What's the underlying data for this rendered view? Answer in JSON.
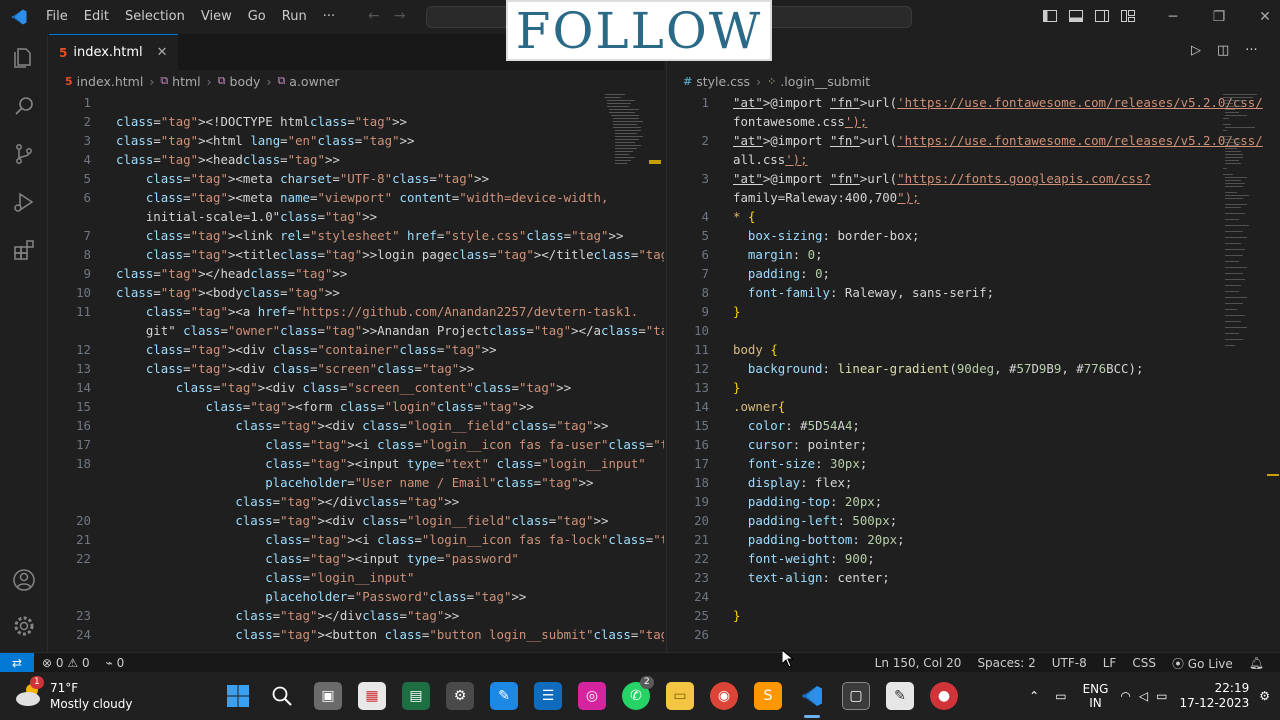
{
  "titlebar": {
    "menu": [
      "File",
      "Edit",
      "Selection",
      "View",
      "Go",
      "Run",
      "···"
    ],
    "icons": [
      "vscode-logo",
      "back-arrow",
      "forward-arrow",
      "toggle-primary-sidebar",
      "toggle-panel",
      "toggle-secondary-sidebar",
      "customize-layout",
      "minimize",
      "restore",
      "close"
    ]
  },
  "overlay": {
    "text": "FOLLOW"
  },
  "activitybar": [
    "explorer-icon",
    "search-icon",
    "source-control-icon",
    "run-debug-icon",
    "extensions-icon",
    "accounts-icon",
    "manage-icon"
  ],
  "left_pane": {
    "tab": "index.html",
    "breadcrumb": [
      "index.html",
      "html",
      "body",
      "a.owner"
    ],
    "lines": [
      {
        "n": "1",
        "t": ""
      },
      {
        "n": "2",
        "t": "<!DOCTYPE html>"
      },
      {
        "n": "3",
        "t": "<html lang=\"en\">"
      },
      {
        "n": "4",
        "t": "<head>"
      },
      {
        "n": "5",
        "t": "    <meta charset=\"UTF-8\">"
      },
      {
        "n": "6",
        "t": "    <meta name=\"viewport\" content=\"width=device-width,"
      },
      {
        "n": "",
        "t": "    initial-scale=1.0\">"
      },
      {
        "n": "7",
        "t": "    <link rel=\"stylesheet\" href=\"style.css\">"
      },
      {
        "n": "8",
        "t": "    <title>login page</title>"
      },
      {
        "n": "9",
        "t": "</head>"
      },
      {
        "n": "10",
        "t": "<body>"
      },
      {
        "n": "11",
        "t": "    <a href=\"https://github.com/Anandan2257/devtern-task1."
      },
      {
        "n": "",
        "t": "    git\" class=\"owner\">Anandan Project</a>"
      },
      {
        "n": "12",
        "t": "    <div class=\"container\">"
      },
      {
        "n": "13",
        "t": "    <div class=\"screen\">"
      },
      {
        "n": "14",
        "t": "        <div class=\"screen__content\">"
      },
      {
        "n": "15",
        "t": "            <form class=\"login\">"
      },
      {
        "n": "16",
        "t": "                <div class=\"login__field\">"
      },
      {
        "n": "17",
        "t": "                    <i class=\"login__icon fas fa-user\"></i>"
      },
      {
        "n": "18",
        "t": "                    <input type=\"text\" class=\"login__input\""
      },
      {
        "n": "",
        "t": "                    placeholder=\"User name / Email\">"
      },
      {
        "n": "",
        "t": "                </div>"
      },
      {
        "n": "20",
        "t": "                <div class=\"login__field\">"
      },
      {
        "n": "21",
        "t": "                    <i class=\"login__icon fas fa-lock\"></i>"
      },
      {
        "n": "22",
        "t": "                    <input type=\"password\""
      },
      {
        "n": "",
        "t": "                    class=\"login__input\""
      },
      {
        "n": "",
        "t": "                    placeholder=\"Password\">"
      },
      {
        "n": "23",
        "t": "                </div>"
      },
      {
        "n": "24",
        "t": "                <button class=\"button login__submit\">"
      }
    ]
  },
  "right_pane": {
    "tab": "style.css",
    "breadcrumb": [
      "style.css",
      ".login__submit"
    ],
    "lines": [
      {
        "n": "1",
        "t": "@import url('https://use.fontawesome.com/releases/v5.2.0/css/"
      },
      {
        "n": "",
        "t": "fontawesome.css');"
      },
      {
        "n": "2",
        "t": "@import url('https://use.fontawesome.com/releases/v5.2.0/css/"
      },
      {
        "n": "",
        "t": "all.css');"
      },
      {
        "n": "3",
        "t": "@import url(\"https://fonts.googleapis.com/css?"
      },
      {
        "n": "",
        "t": "family=Raleway:400,700\");"
      },
      {
        "n": "4",
        "t": "* {"
      },
      {
        "n": "5",
        "t": "  box-sizing: border-box;"
      },
      {
        "n": "6",
        "t": "  margin: 0;"
      },
      {
        "n": "7",
        "t": "  padding: 0;"
      },
      {
        "n": "8",
        "t": "  font-family: Raleway, sans-serif;"
      },
      {
        "n": "9",
        "t": "}"
      },
      {
        "n": "10",
        "t": ""
      },
      {
        "n": "11",
        "t": "body {"
      },
      {
        "n": "12",
        "t": "  background: linear-gradient(90deg, #57D9B9, #776BCC);"
      },
      {
        "n": "13",
        "t": "}"
      },
      {
        "n": "14",
        "t": ".owner{"
      },
      {
        "n": "15",
        "t": "  color: #5D54A4;"
      },
      {
        "n": "16",
        "t": "  cursor: pointer;"
      },
      {
        "n": "17",
        "t": "  font-size: 30px;"
      },
      {
        "n": "18",
        "t": "  display: flex;"
      },
      {
        "n": "19",
        "t": "  padding-top: 20px;"
      },
      {
        "n": "20",
        "t": "  padding-left: 500px;"
      },
      {
        "n": "21",
        "t": "  padding-bottom: 20px;"
      },
      {
        "n": "22",
        "t": "  font-weight: 900;"
      },
      {
        "n": "23",
        "t": "  text-align: center;"
      },
      {
        "n": "24",
        "t": ""
      },
      {
        "n": "25",
        "t": "}"
      },
      {
        "n": "26",
        "t": ""
      }
    ],
    "colors": {
      "c1": "#57D9B9",
      "c2": "#776BCC",
      "c3": "#5D54A4"
    }
  },
  "statusbar": {
    "errors": "0",
    "warnings": "0",
    "ports": "0",
    "position": "Ln 150, Col 20",
    "spaces": "Spaces: 2",
    "encoding": "UTF-8",
    "eol": "LF",
    "language": "CSS",
    "golive": "Go Live"
  },
  "taskbar": {
    "weather_temp": "71°F",
    "weather_desc": "Mostly cloudy",
    "weather_badge": "1",
    "whatsapp_badge": "2",
    "lang1": "ENG",
    "lang2": "IN",
    "time": "22:19",
    "date": "17-12-2023"
  }
}
